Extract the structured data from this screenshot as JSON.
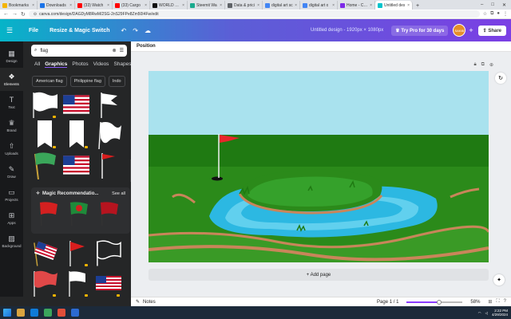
{
  "browser": {
    "tabs": [
      {
        "label": "Bookmarks",
        "color": "#f4b400"
      },
      {
        "label": "Downloads",
        "color": "#1a73e8"
      },
      {
        "label": "(33) Watch",
        "color": "#ff0000"
      },
      {
        "label": "(33) Cargo",
        "color": "#ff0000"
      },
      {
        "label": "WORLD CUP",
        "color": "#111111"
      },
      {
        "label": "Steemit Wa",
        "color": "#1aaa8e"
      },
      {
        "label": "Data & prici",
        "color": "#5f6368"
      },
      {
        "label": "digital art sc",
        "color": "#4285f4"
      },
      {
        "label": "digital art o",
        "color": "#4285f4"
      },
      {
        "label": "Home - Canv",
        "color": "#7d2ae8"
      },
      {
        "label": "Untitled des",
        "color": "#00c4cc",
        "active": true
      }
    ],
    "url": "canva.com/design/DAGDyM8RwM/2SG-2nS29FPe8Zm50I4Fw/edit"
  },
  "header": {
    "file": "File",
    "resize": "Resize & Magic Switch",
    "title": "Untitled design - 1920px × 1080px",
    "try_pro": "Try Pro for 30 days",
    "avatar": "SAKIB",
    "share": "Share"
  },
  "rail": [
    {
      "label": "Design",
      "icon": "design-icon"
    },
    {
      "label": "Elements",
      "icon": "elements-icon",
      "selected": true
    },
    {
      "label": "Text",
      "icon": "text-icon"
    },
    {
      "label": "Brand",
      "icon": "brand-icon"
    },
    {
      "label": "Uploads",
      "icon": "uploads-icon"
    },
    {
      "label": "Draw",
      "icon": "draw-icon"
    },
    {
      "label": "Projects",
      "icon": "projects-icon"
    },
    {
      "label": "Apps",
      "icon": "apps-icon"
    },
    {
      "label": "Background",
      "icon": "background-icon"
    }
  ],
  "panel": {
    "search_value": "flag",
    "categories": [
      "All",
      "Graphics",
      "Photos",
      "Videos",
      "Shapes"
    ],
    "active_category": "Graphics",
    "chips": [
      "American flag",
      "Philippine flag",
      "Indo"
    ],
    "magic_title": "Magic Recommendatio...",
    "see_all": "See all"
  },
  "workspace": {
    "position": "Position",
    "add_page": "+ Add page"
  },
  "footer": {
    "notes": "Notes",
    "page": "Page 1 / 1",
    "zoom": "58%",
    "zoom_fraction": 0.58
  },
  "taskbar": {
    "time": "2:22 PM",
    "date": "4/29/2024"
  },
  "colors": {
    "sky": "#a9e2ee",
    "grass": "#2b8a1a",
    "water": "#2cb8e2",
    "sand": "#c9855a",
    "accent": "#8b3dff"
  }
}
